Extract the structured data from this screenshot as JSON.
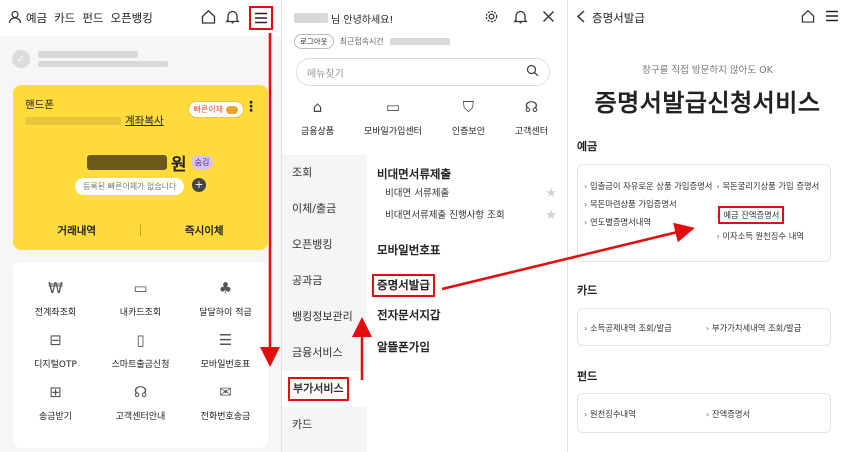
{
  "panel1": {
    "nav": [
      "예금",
      "카드",
      "펀드",
      "오픈뱅킹"
    ],
    "card": {
      "label": "핸드폰",
      "copy_link": "계좌복사",
      "quick_pill": "빠른이체",
      "balance_unit": "원",
      "hide_badge": "숨김",
      "register_pill": "등록된 빠른이체가 없습니다",
      "btn_history": "거래내역",
      "btn_transfer": "즉시이체"
    },
    "grid": [
      {
        "label": "전계좌조회",
        "icon": "coin-search-icon"
      },
      {
        "label": "내카드조회",
        "icon": "card-icon"
      },
      {
        "label": "달달하이 적금",
        "icon": "plant-pot-icon"
      },
      {
        "label": "디지털OTP",
        "icon": "otp-device-icon"
      },
      {
        "label": "스마트출금신청",
        "icon": "smart-withdraw-icon"
      },
      {
        "label": "모바일번호표",
        "icon": "ticket-icon"
      },
      {
        "label": "송금받기",
        "icon": "receive-money-icon"
      },
      {
        "label": "고객센터안내",
        "icon": "headset-icon"
      },
      {
        "label": "전화번호송금",
        "icon": "phone-send-icon"
      }
    ]
  },
  "panel2": {
    "greeting_suffix": "님 안녕하세요!",
    "logout": "로그아웃",
    "last_login": "최근접속시간",
    "search_placeholder": "메뉴찾기",
    "icons": [
      {
        "label": "금융상품",
        "icon": "bank-icon"
      },
      {
        "label": "모바일가입센터",
        "icon": "laptop-icon"
      },
      {
        "label": "인증보안",
        "icon": "shield-lock-icon"
      },
      {
        "label": "고객센터",
        "icon": "headset-icon"
      }
    ],
    "left_nav": [
      "조회",
      "이체/출금",
      "오픈뱅킹",
      "공과금",
      "뱅킹정보관리",
      "금융서비스",
      "부가서비스",
      "카드"
    ],
    "section1": "비대면서류제출",
    "section1_items": [
      "비대면 서류제출",
      "비대면서류제출 진행사항 조회"
    ],
    "section2": "모바일번호표",
    "section3": "증명서발급",
    "section4": "전자문서지갑",
    "section5": "알뜰폰가입"
  },
  "panel3": {
    "title": "증명서발급",
    "subtitle": "창구를 직접 방문하지 않아도 OK",
    "heading": "증명서발급신청서비스",
    "sections": [
      {
        "name": "예금",
        "items": [
          "입출금이 자유로운 상품 가입증명서",
          "목돈굴리기상품 가입 증명서",
          "목돈마련상품 가입증명서",
          "예금 잔액증명서",
          "연도별증명서내역",
          "이자소득 원천징수 내역"
        ]
      },
      {
        "name": "카드",
        "items": [
          "소득공제내역 조회/발급",
          "부가가치세내역 조회/발급"
        ]
      },
      {
        "name": "펀드",
        "items": [
          "원천징수내역",
          "잔액증명서"
        ]
      }
    ]
  },
  "colors": {
    "highlight": "#e30d0d",
    "card_yellow": "#ffdb3c"
  }
}
